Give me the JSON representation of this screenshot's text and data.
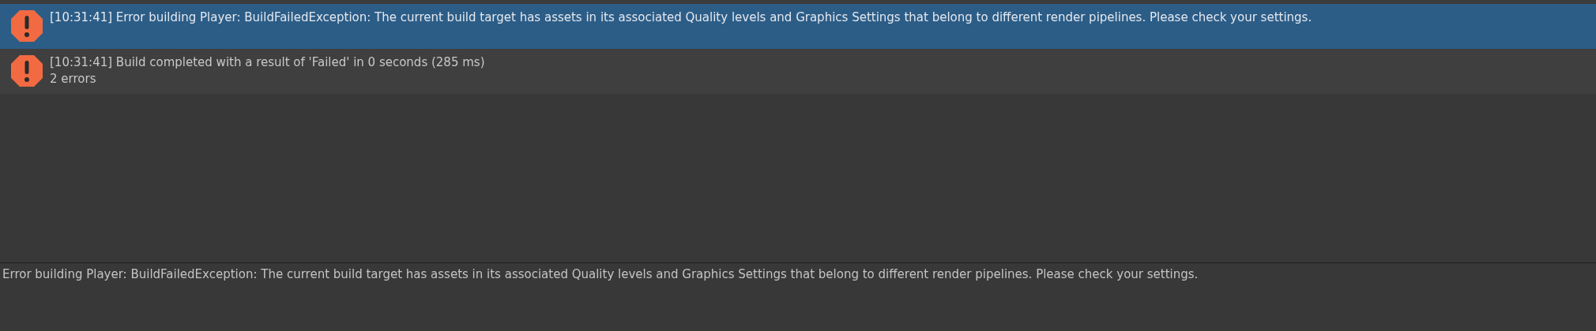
{
  "console": {
    "entries": [
      {
        "kind": "error",
        "selected": true,
        "lines": [
          "[10:31:41] Error building Player: BuildFailedException: The current build target has assets in its associated Quality levels and Graphics Settings that belong to different render pipelines. Please check your settings."
        ]
      },
      {
        "kind": "error",
        "selected": false,
        "lines": [
          "[10:31:41] Build completed with a result of 'Failed' in 0 seconds (285 ms)",
          "2 errors"
        ]
      }
    ]
  },
  "details": {
    "text": "Error building Player: BuildFailedException: The current build target has assets in its associated Quality levels and Graphics Settings that belong to different render pipelines. Please check your settings."
  }
}
